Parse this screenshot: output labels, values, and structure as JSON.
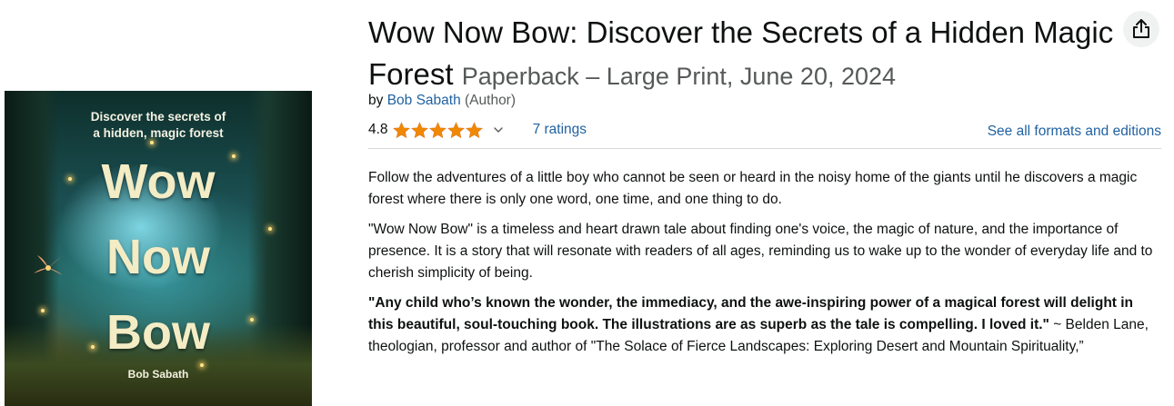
{
  "cover": {
    "subtitle_line1": "Discover the secrets of",
    "subtitle_line2": "a hidden, magic forest",
    "word1": "Wow",
    "word2": "Now",
    "word3": "Bow",
    "author": "Bob Sabath"
  },
  "product": {
    "title": "Wow Now Bow: Discover the Secrets of a Hidden Magic Forest",
    "format": "Paperback – Large Print, June 20, 2024",
    "by_label": "by",
    "author": "Bob Sabath",
    "author_role": "(Author)",
    "rating": "4.8",
    "stars_filled": 5,
    "ratings_link": "7 ratings",
    "formats_link": "See all formats and editions"
  },
  "description": {
    "p1": "Follow the adventures of a little boy who cannot be seen or heard in the noisy home of the giants until he discovers a magic forest where there is only one word, one time, and one thing to do.",
    "p2": "\"Wow Now Bow\" is a timeless and heart drawn tale about finding one's voice, the magic of nature, and the importance of presence. It is a story that will resonate with readers of all ages, reminding us to wake up to the wonder of everyday life and to cherish simplicity of being.",
    "quote_bold": "\"Any child who’s known the wonder, the immediacy, and the awe-inspiring power of a magical forest will delight in this beautiful, soul-touching book. The illustrations are as superb as the tale is compelling. I loved it.\"",
    "quote_attribution": " ~ Belden Lane, theologian, professor and author of \"The Solace of Fierce Landscapes: Exploring Desert and Mountain Spirituality,”"
  },
  "colors": {
    "link": "#2162a1",
    "star": "#f08804",
    "text": "#0f1111",
    "muted": "#565959"
  },
  "icons": {
    "share": "share-icon",
    "star": "star-icon",
    "chevron": "chevron-down-icon"
  }
}
